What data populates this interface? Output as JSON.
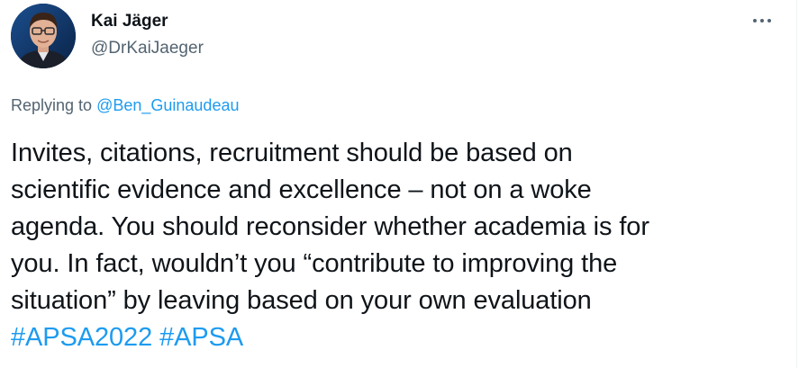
{
  "author": {
    "name": "Kai Jäger",
    "handle": "@DrKaiJaeger"
  },
  "more_menu": {
    "icon": "more-horizontal-icon"
  },
  "reply_context": {
    "prefix": "Replying to",
    "mention": "@Ben_Guinaudeau"
  },
  "tweet": {
    "lines": [
      "Invites, citations, recruitment should be based on",
      "scientific evidence and excellence – not on a woke",
      "agenda. You should reconsider whether academia is for",
      "you. In fact, wouldn’t you “contribute to improving the",
      "situation” by leaving based on your own evaluation"
    ],
    "hashtags": [
      "#APSA2022",
      "#APSA"
    ]
  },
  "colors": {
    "link": "#1d9bf0",
    "secondary_text": "#536471",
    "primary_text": "#0f1419"
  }
}
